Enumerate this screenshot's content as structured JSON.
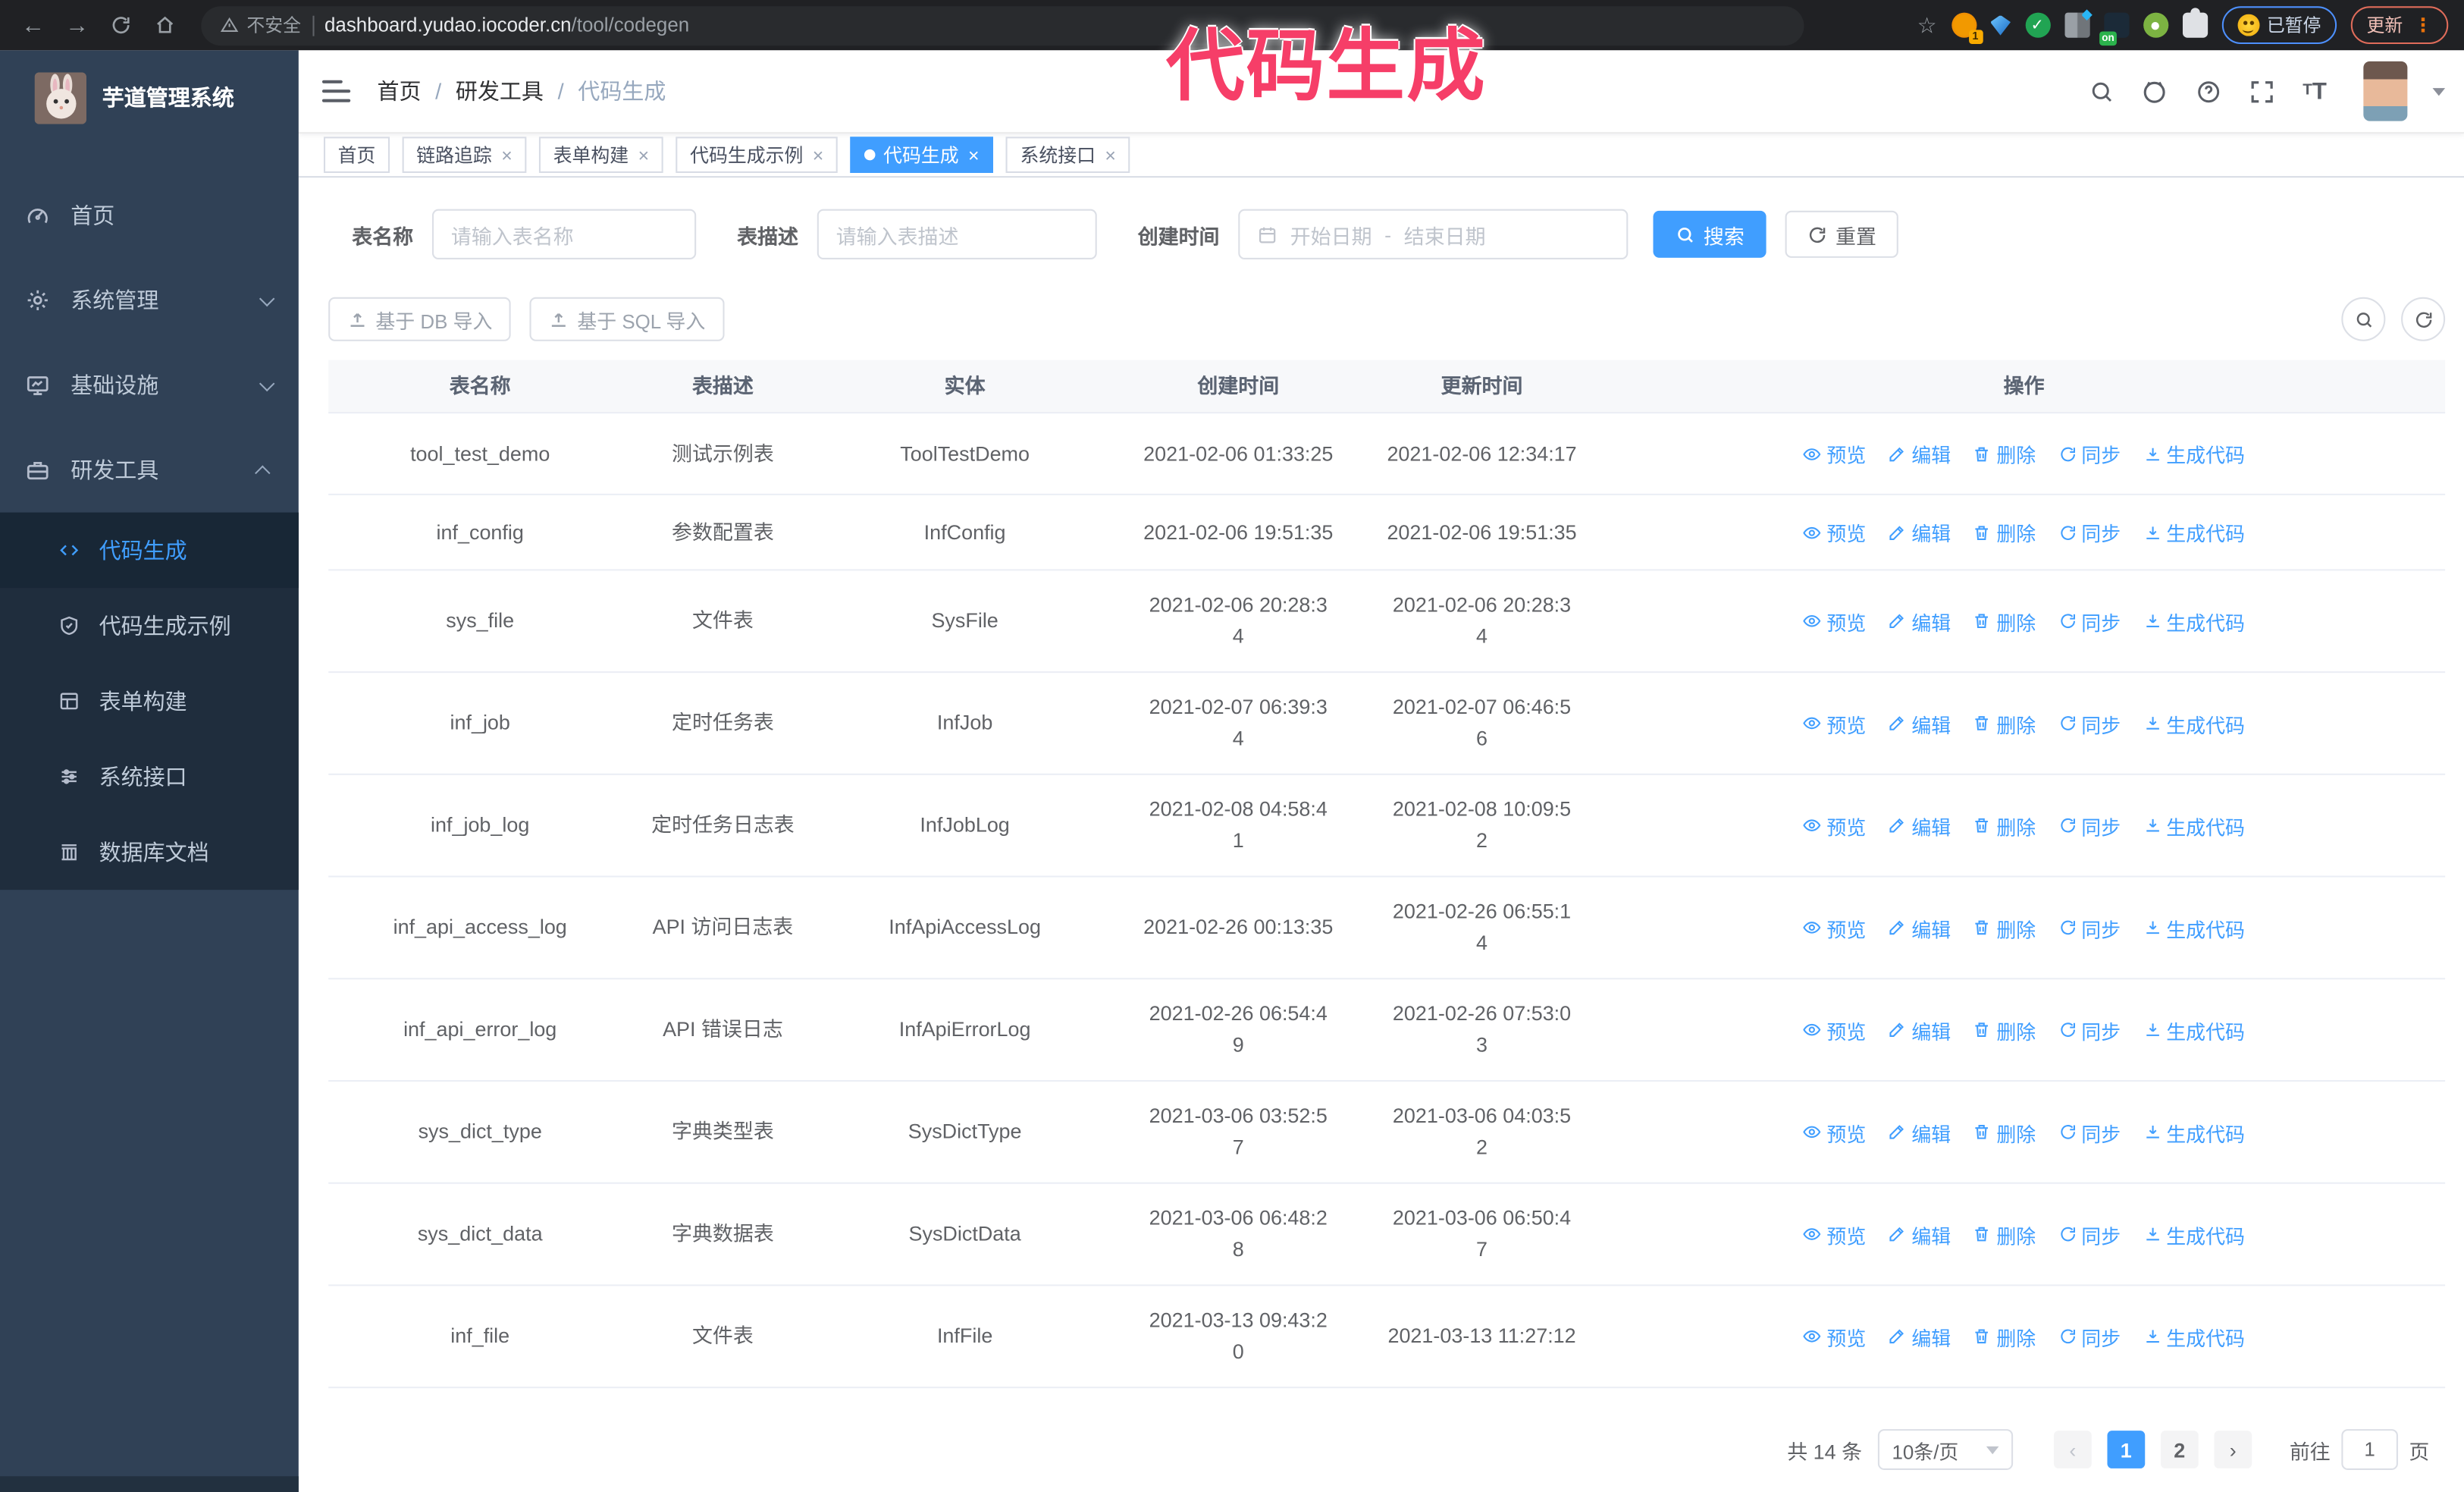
{
  "browser": {
    "security_label": "不安全",
    "url_host": "dashboard.yudao.iocoder.cn",
    "url_path": "/tool/codegen",
    "paused_label": "已暂停",
    "update_label": "更新",
    "extensions": [
      {
        "id": "ext-orange",
        "badge": "1"
      },
      {
        "id": "ext-gem"
      },
      {
        "id": "ext-green-check",
        "glyph": "✓"
      },
      {
        "id": "ext-grid"
      },
      {
        "id": "ext-on",
        "badge": "on"
      },
      {
        "id": "ext-key"
      },
      {
        "id": "ext-puzzle"
      }
    ]
  },
  "annotation": {
    "text": "代码生成"
  },
  "sidebar": {
    "title": "芋道管理系统",
    "menu": [
      {
        "label": "首页",
        "icon": "gauge-icon"
      },
      {
        "label": "系统管理",
        "icon": "gear-icon",
        "chevron": "down"
      },
      {
        "label": "基础设施",
        "icon": "monitor-icon",
        "chevron": "down"
      },
      {
        "label": "研发工具",
        "icon": "toolbox-icon",
        "chevron": "up",
        "children": [
          {
            "label": "代码生成",
            "icon": "code-icon",
            "active": true
          },
          {
            "label": "代码生成示例",
            "icon": "shield-check-icon"
          },
          {
            "label": "表单构建",
            "icon": "form-icon"
          },
          {
            "label": "系统接口",
            "icon": "sliders-icon"
          },
          {
            "label": "数据库文档",
            "icon": "db-columns-icon"
          }
        ]
      }
    ]
  },
  "breadcrumb": [
    "首页",
    "研发工具",
    "代码生成"
  ],
  "tabs": [
    {
      "label": "首页",
      "closable": false
    },
    {
      "label": "链路追踪",
      "closable": true
    },
    {
      "label": "表单构建",
      "closable": true
    },
    {
      "label": "代码生成示例",
      "closable": true
    },
    {
      "label": "代码生成",
      "closable": true,
      "active": true
    },
    {
      "label": "系统接口",
      "closable": true
    }
  ],
  "search": {
    "name_label": "表名称",
    "name_placeholder": "请输入表名称",
    "desc_label": "表描述",
    "desc_placeholder": "请输入表描述",
    "time_label": "创建时间",
    "start_placeholder": "开始日期",
    "range_separator": "-",
    "end_placeholder": "结束日期",
    "search_label": "搜索",
    "reset_label": "重置"
  },
  "toolbar": {
    "db_import_label": "基于 DB 导入",
    "sql_import_label": "基于 SQL 导入"
  },
  "table": {
    "headers": [
      "表名称",
      "表描述",
      "实体",
      "创建时间",
      "更新时间",
      "操作"
    ],
    "actions": [
      {
        "label": "预览",
        "icon": "eye-icon"
      },
      {
        "label": "编辑",
        "icon": "edit-icon"
      },
      {
        "label": "删除",
        "icon": "delete-icon"
      },
      {
        "label": "同步",
        "icon": "sync-icon"
      },
      {
        "label": "生成代码",
        "icon": "download-icon"
      }
    ],
    "rows": [
      {
        "name": "tool_test_demo",
        "desc": "测试示例表",
        "entity": "ToolTestDemo",
        "created": "2021-02-06 01:33:25",
        "updated": "2021-02-06 12:34:17",
        "size": "h1"
      },
      {
        "name": "inf_config",
        "desc": "参数配置表",
        "entity": "InfConfig",
        "created": "2021-02-06 19:51:35",
        "updated": "2021-02-06 19:51:35",
        "size": "h1b"
      },
      {
        "name": "sys_file",
        "desc": "文件表",
        "entity": "SysFile",
        "created": "2021-02-06 20:28:3\n4",
        "updated": "2021-02-06 20:28:3\n4",
        "size": "h2"
      },
      {
        "name": "inf_job",
        "desc": "定时任务表",
        "entity": "InfJob",
        "created": "2021-02-07 06:39:3\n4",
        "updated": "2021-02-07 06:46:5\n6",
        "size": "h2"
      },
      {
        "name": "inf_job_log",
        "desc": "定时任务日志表",
        "entity": "InfJobLog",
        "created": "2021-02-08 04:58:4\n1",
        "updated": "2021-02-08 10:09:5\n2",
        "size": "h2"
      },
      {
        "name": "inf_api_access_log",
        "desc": "API 访问日志表",
        "entity": "InfApiAccessLog",
        "created": "2021-02-26 00:13:35",
        "updated": "2021-02-26 06:55:1\n4",
        "size": "h2"
      },
      {
        "name": "inf_api_error_log",
        "desc": "API 错误日志",
        "entity": "InfApiErrorLog",
        "created": "2021-02-26 06:54:4\n9",
        "updated": "2021-02-26 07:53:0\n3",
        "size": "h2"
      },
      {
        "name": "sys_dict_type",
        "desc": "字典类型表",
        "entity": "SysDictType",
        "created": "2021-03-06 03:52:5\n7",
        "updated": "2021-03-06 04:03:5\n2",
        "size": "h2"
      },
      {
        "name": "sys_dict_data",
        "desc": "字典数据表",
        "entity": "SysDictData",
        "created": "2021-03-06 06:48:2\n8",
        "updated": "2021-03-06 06:50:4\n7",
        "size": "h2"
      },
      {
        "name": "inf_file",
        "desc": "文件表",
        "entity": "InfFile",
        "created": "2021-03-13 09:43:2\n0",
        "updated": "2021-03-13 11:27:12",
        "size": "h2"
      }
    ]
  },
  "pagination": {
    "total_label": "共 14 条",
    "page_size_label": "10条/页",
    "pages": [
      "1",
      "2"
    ],
    "active_page": "1",
    "prev_glyph": "‹",
    "next_glyph": "›",
    "goto_label": "前往",
    "goto_value": "1",
    "page_suffix": "页"
  },
  "colors": {
    "accent": "#409eff",
    "sidebar_bg": "#304156",
    "submenu_bg": "#1f2d3d",
    "active_tag": "#409eff",
    "annotation_pink": "#f63e68"
  }
}
